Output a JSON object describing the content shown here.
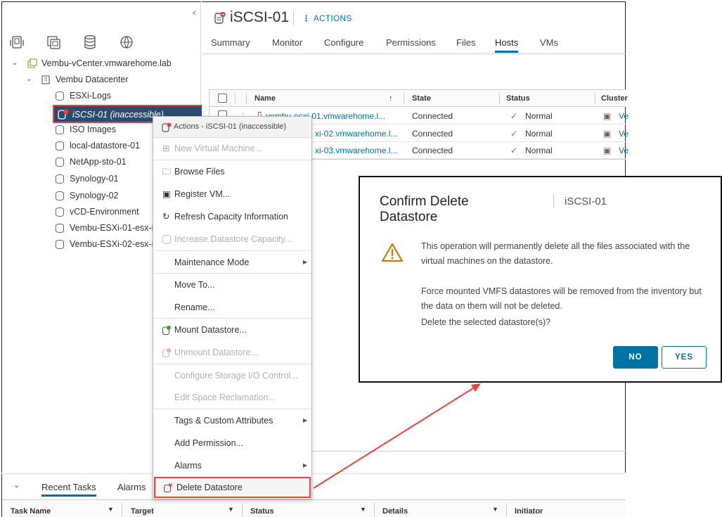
{
  "colors": {
    "accent": "#0072a3",
    "highlight": "#e8423f",
    "selected_bg": "#2b4c6f"
  },
  "navigator": {
    "collapse_icon": "chevron-left-icon",
    "view_icons": [
      "hosts-clusters-icon",
      "vms-templates-icon",
      "storage-icon",
      "networking-icon"
    ],
    "tree": {
      "vcenter": "Vembu-vCenter.vmwarehome.lab",
      "datacenter": "Vembu Datacenter",
      "datastores": [
        "ESXi-Logs",
        "iSCSI-01 (inaccessible)",
        "ISO Images",
        "local-datastore-01",
        "NetApp-sto-01",
        "Synology-01",
        "Synology-02",
        "vCD-Environment",
        "Vembu-ESXi-01-esx-i",
        "Vembu-ESXi-02-esx-i"
      ]
    }
  },
  "header": {
    "title": "iSCSI-01",
    "actions_label": "ACTIONS",
    "tabs": [
      "Summary",
      "Monitor",
      "Configure",
      "Permissions",
      "Files",
      "Hosts",
      "VMs"
    ],
    "active_tab": "Hosts"
  },
  "hosts_grid": {
    "columns": [
      "Name",
      "State",
      "Status",
      "Cluster"
    ],
    "rows": [
      {
        "name": "vembu-esxi-01.vmwarehome.l...",
        "state": "Connected",
        "status": "Normal",
        "cluster": "Ve"
      },
      {
        "name": "xi-02.vmwarehome.l...",
        "state": "Connected",
        "status": "Normal",
        "cluster": "Ve"
      },
      {
        "name": "xi-03.vmwarehome.l...",
        "state": "Connected",
        "status": "Normal",
        "cluster": "Ve"
      }
    ]
  },
  "context_menu": {
    "header": "Actions - iSCSI-01 (inaccessible)",
    "items": {
      "new_vm": "New Virtual Machine...",
      "browse_files": "Browse Files",
      "register_vm": "Register VM...",
      "refresh_capacity": "Refresh Capacity Information",
      "increase_capacity": "Increase Datastore Capacity...",
      "maintenance_mode": "Maintenance Mode",
      "move_to": "Move To...",
      "rename": "Rename...",
      "mount": "Mount Datastore...",
      "unmount": "Unmount Datastore...",
      "configure_sioc": "Configure Storage I/O Control...",
      "edit_space": "Edit Space Reclamation...",
      "tags": "Tags & Custom Attributes",
      "add_permission": "Add Permission...",
      "alarms": "Alarms",
      "delete": "Delete Datastore"
    }
  },
  "bottom_panel": {
    "tabs": [
      "Recent Tasks",
      "Alarms"
    ],
    "columns": [
      "Task Name",
      "Target",
      "Status",
      "Details",
      "Initiator"
    ]
  },
  "dialog": {
    "title": "Confirm Delete Datastore",
    "subtitle": "iSCSI-01",
    "message_1": "This operation will permanently delete all the files associated with the virtual machines on the datastore.",
    "message_2": "Force mounted VMFS datastores will be removed from the inventory but the data on them will not be deleted.",
    "message_3": "Delete the selected datastore(s)?",
    "no_label": "NO",
    "yes_label": "YES"
  }
}
